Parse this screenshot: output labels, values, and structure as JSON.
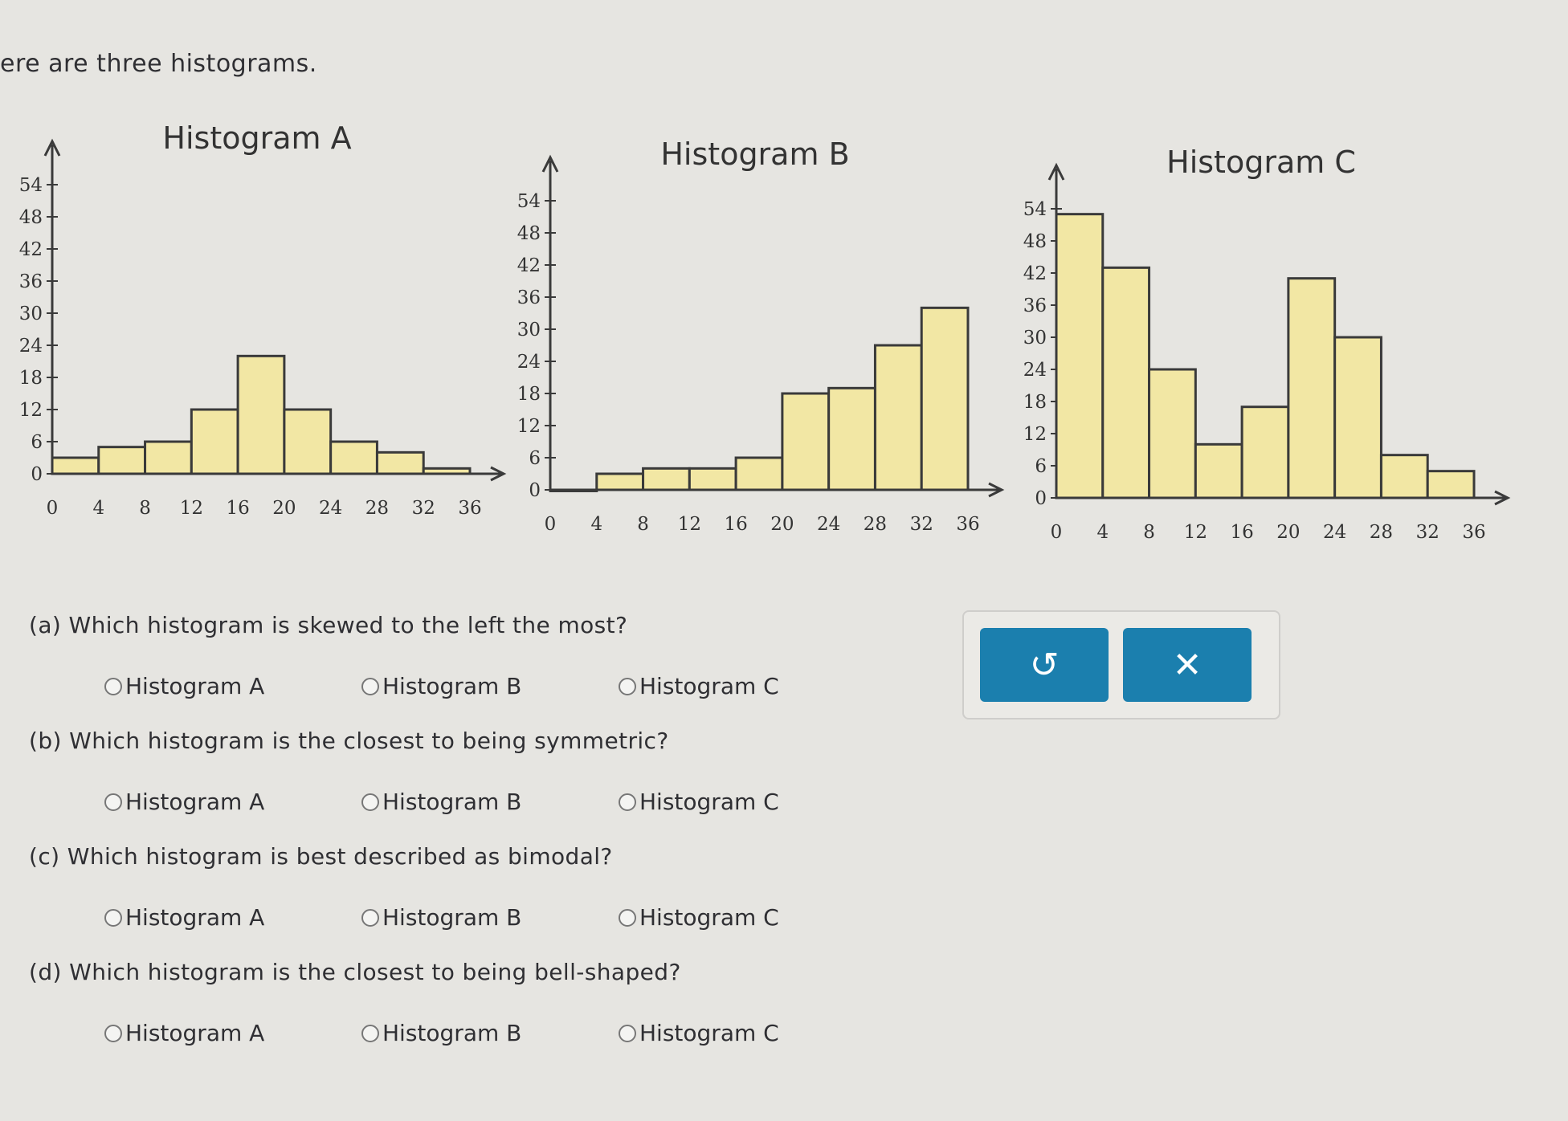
{
  "intro_text": "ere are three histograms.",
  "histograms": [
    {
      "id": "A",
      "title": "Histogram A"
    },
    {
      "id": "B",
      "title": "Histogram B"
    },
    {
      "id": "C",
      "title": "Histogram C"
    }
  ],
  "chart_data": [
    {
      "type": "bar",
      "title": "Histogram A",
      "x_ticks": [
        0,
        4,
        8,
        12,
        16,
        20,
        24,
        28,
        32,
        36
      ],
      "y_ticks": [
        0,
        6,
        12,
        18,
        24,
        30,
        36,
        42,
        48,
        54
      ],
      "bin_width": 4,
      "bins": [
        0,
        4,
        8,
        12,
        16,
        20,
        24,
        28,
        32
      ],
      "values": [
        3,
        5,
        6,
        12,
        22,
        12,
        6,
        4,
        1
      ],
      "xlim": [
        0,
        36
      ],
      "ylim": [
        0,
        54
      ]
    },
    {
      "type": "bar",
      "title": "Histogram B",
      "x_ticks": [
        0,
        4,
        8,
        12,
        16,
        20,
        24,
        28,
        32,
        36
      ],
      "y_ticks": [
        0,
        6,
        12,
        18,
        24,
        30,
        36,
        42,
        48,
        54
      ],
      "bin_width": 4,
      "bins": [
        0,
        4,
        8,
        12,
        16,
        20,
        24,
        28,
        32
      ],
      "values": [
        0,
        3,
        4,
        4,
        6,
        18,
        19,
        27,
        34
      ],
      "xlim": [
        0,
        36
      ],
      "ylim": [
        0,
        54
      ]
    },
    {
      "type": "bar",
      "title": "Histogram C",
      "x_ticks": [
        0,
        4,
        8,
        12,
        16,
        20,
        24,
        28,
        32,
        36
      ],
      "y_ticks": [
        0,
        6,
        12,
        18,
        24,
        30,
        36,
        42,
        48,
        54
      ],
      "bin_width": 4,
      "bins": [
        0,
        4,
        8,
        12,
        16,
        20,
        24,
        28,
        32
      ],
      "values": [
        53,
        43,
        24,
        10,
        17,
        41,
        30,
        8,
        5
      ],
      "xlim": [
        0,
        36
      ],
      "ylim": [
        0,
        54
      ]
    }
  ],
  "colors": {
    "bar_fill": "#f2e7a4",
    "bar_stroke": "#3a3a3a",
    "axis": "#3a3a3a",
    "button": "#1b7fae"
  },
  "questions": [
    {
      "label": "(a) Which histogram is skewed to the left the most?",
      "options": [
        "Histogram A",
        "Histogram B",
        "Histogram C"
      ]
    },
    {
      "label": "(b) Which histogram is the closest to being symmetric?",
      "options": [
        "Histogram A",
        "Histogram B",
        "Histogram C"
      ]
    },
    {
      "label": "(c) Which histogram is best described as bimodal?",
      "options": [
        "Histogram A",
        "Histogram B",
        "Histogram C"
      ]
    },
    {
      "label": "(d) Which histogram is the closest to being bell-shaped?",
      "options": [
        "Histogram A",
        "Histogram B",
        "Histogram C"
      ]
    }
  ],
  "tools": {
    "reset_icon": "undo-icon",
    "reset_glyph": "↺",
    "clear_icon": "close-icon",
    "clear_glyph": "✕"
  }
}
